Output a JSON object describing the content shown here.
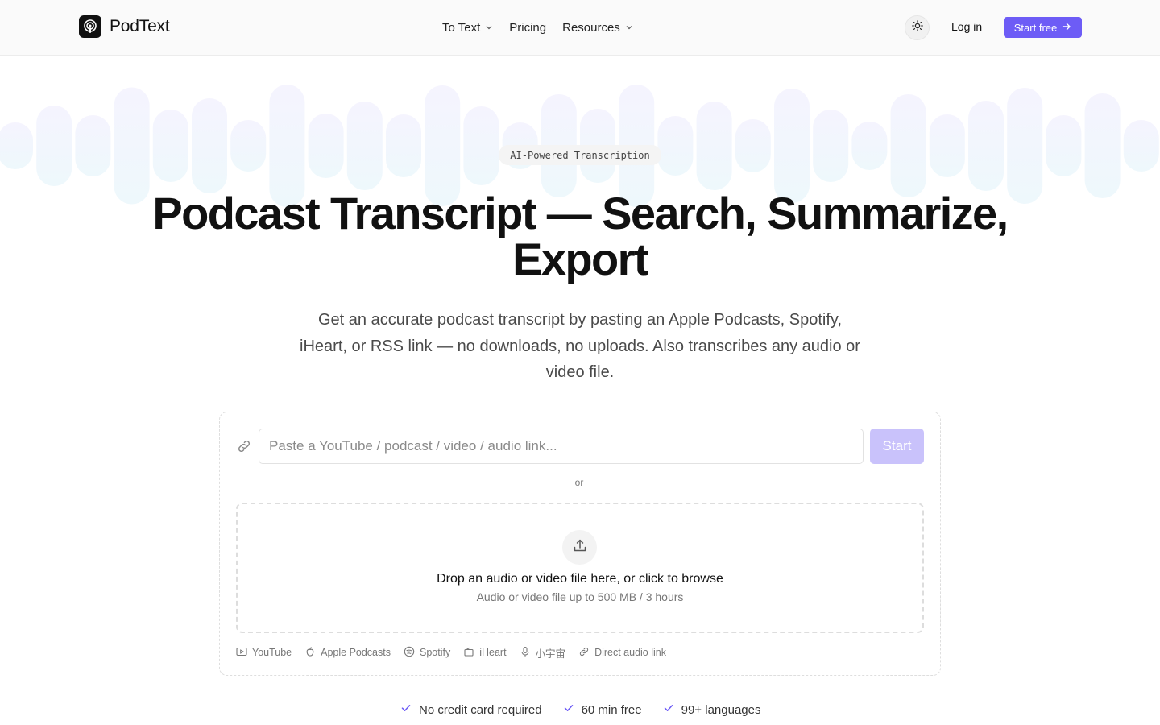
{
  "header": {
    "brand": "PodText",
    "nav": [
      {
        "label": "To Text",
        "dropdown": true
      },
      {
        "label": "Pricing",
        "dropdown": false
      },
      {
        "label": "Resources",
        "dropdown": true
      }
    ],
    "theme_toggle_icon": "sun-icon",
    "login_label": "Log in",
    "cta_label": "Start free"
  },
  "hero": {
    "eyebrow": "AI-Powered Transcription",
    "title_line1": "Podcast Transcript — Search, Summarize,",
    "title_line2": "Export",
    "subtitle_line1": "Get an accurate podcast transcript by pasting an Apple Podcasts, Spotify,",
    "subtitle_line2": "iHeart, or RSS link — no downloads, no uploads. Also transcribes any audio or",
    "subtitle_line3": "video file."
  },
  "converter": {
    "url_placeholder": "Paste a YouTube / podcast / video / audio link...",
    "url_value": "",
    "start_label": "Start",
    "divider_text": "or",
    "drop_title": "Drop an audio or video file here, or click to browse",
    "drop_subtitle": "Audio or video file up to 500 MB / 3 hours",
    "sources": [
      {
        "label": "YouTube",
        "icon": "youtube-icon"
      },
      {
        "label": "Apple Podcasts",
        "icon": "apple-icon"
      },
      {
        "label": "Spotify",
        "icon": "spotify-icon"
      },
      {
        "label": "iHeart",
        "icon": "radio-icon"
      },
      {
        "label": "小宇宙",
        "icon": "microphone-icon"
      },
      {
        "label": "Direct audio link",
        "icon": "link-icon"
      }
    ]
  },
  "features": [
    "No credit card required",
    "60 min free",
    "99+ languages"
  ],
  "colors": {
    "accent": "#6d5cf6",
    "accent_disabled": "#c9c2fb",
    "check": "#6d5cf6",
    "wave": "#eef8fc"
  }
}
